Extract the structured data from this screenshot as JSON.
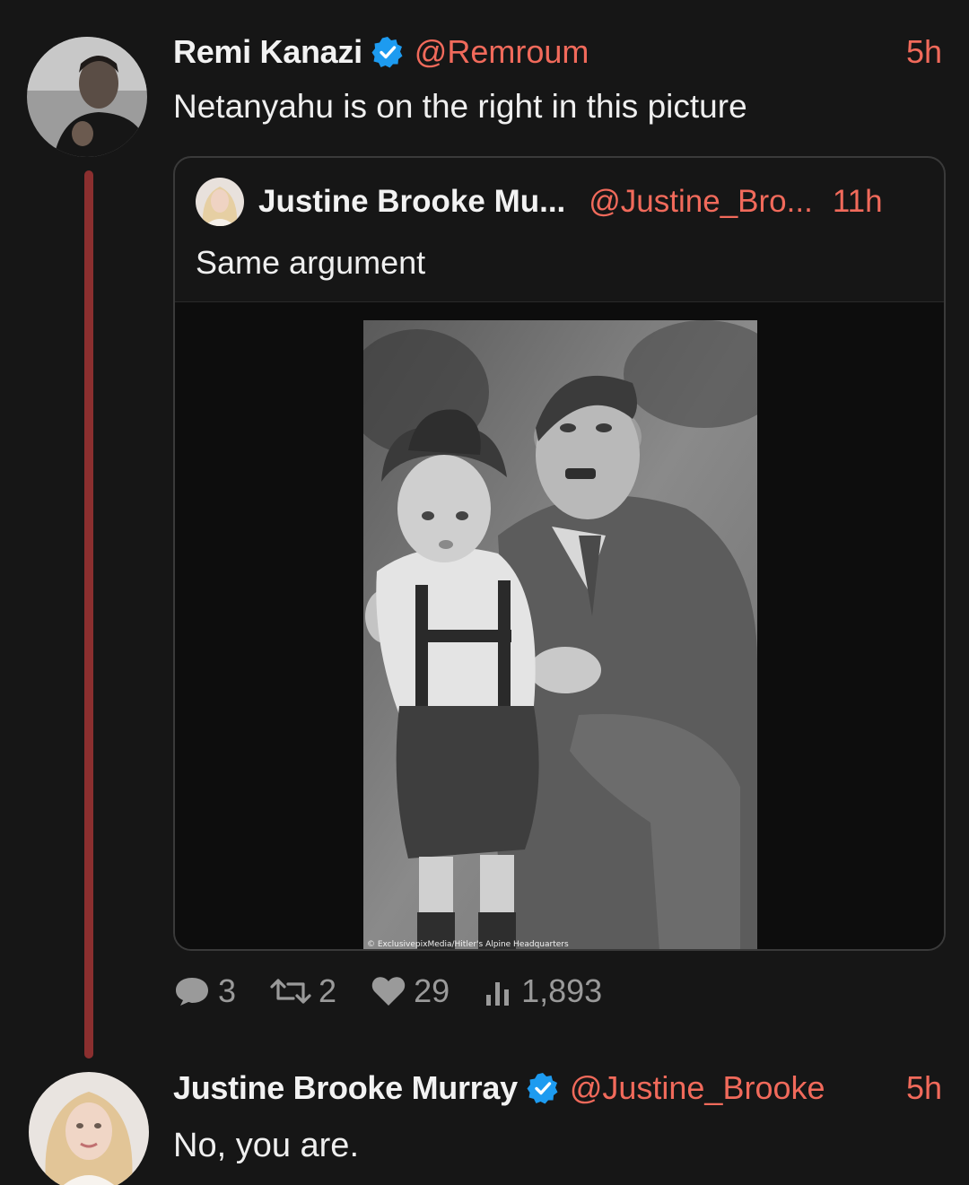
{
  "tweet": {
    "author_name": "Remi Kanazi",
    "handle": "@Remroum",
    "time": "5h",
    "text": "Netanyahu is on the right in this picture",
    "verified": true
  },
  "quoted_tweet": {
    "author_name": "Justine Brooke Mu...",
    "handle": "@Justine_Bro...",
    "time": "11h",
    "text": "Same argument",
    "image_caption": "© ExclusivepixMedia/Hitler's Alpine Headquarters"
  },
  "stats": {
    "replies": "3",
    "retweets": "2",
    "likes": "29",
    "views": "1,893"
  },
  "reply": {
    "author_name": "Justine Brooke Murray",
    "handle": "@Justine_Brooke",
    "time": "5h",
    "text": "No, you are.",
    "verified": true
  },
  "colors": {
    "background": "#161616",
    "accent": "#f16a5b",
    "thread_line": "#8b2f2f",
    "verified_blue": "#1d9bf0",
    "stat_gray": "#9a9a9a"
  }
}
